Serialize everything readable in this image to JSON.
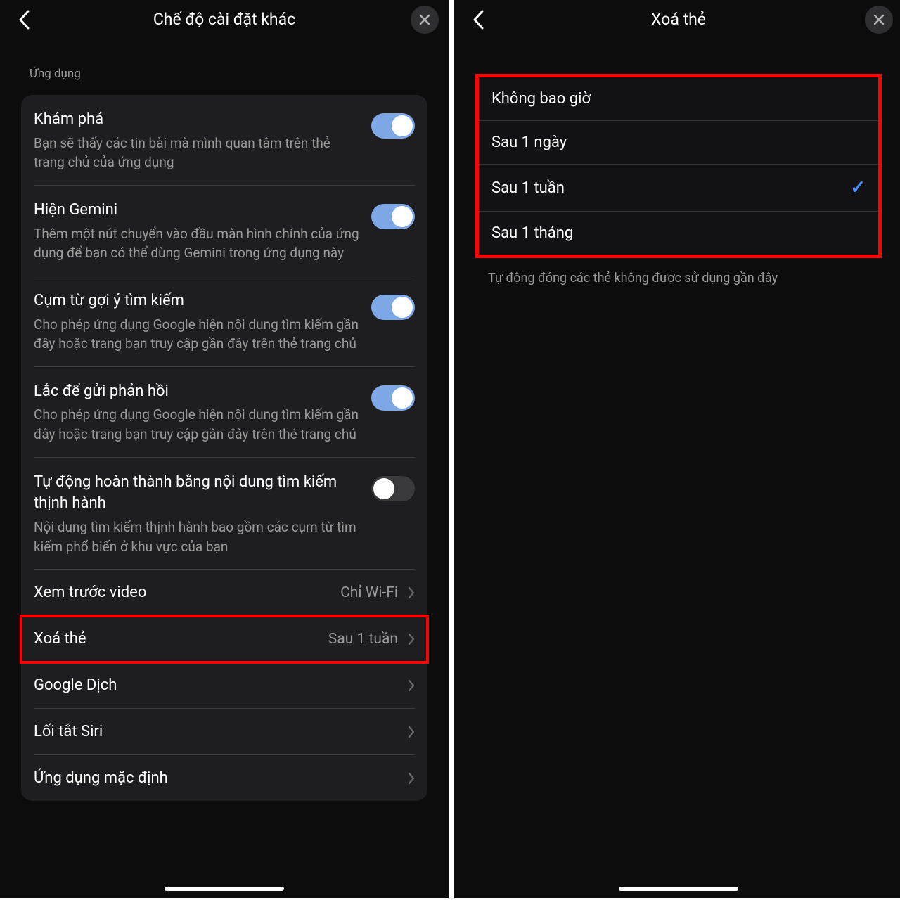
{
  "left": {
    "header": {
      "title": "Chế độ cài đặt khác"
    },
    "section_label": "Ứng dụng",
    "rows": [
      {
        "title": "Khám phá",
        "desc": "Bạn sẽ thấy các tin bài mà mình quan tâm trên thẻ trang chủ của ứng dụng",
        "toggle": true
      },
      {
        "title": "Hiện Gemini",
        "desc": "Thêm một nút chuyển vào đầu màn hình chính của ứng dụng để bạn có thể dùng Gemini trong ứng dụng này",
        "toggle": true
      },
      {
        "title": "Cụm từ gợi ý tìm kiếm",
        "desc": "Cho phép ứng dụng Google hiện nội dung tìm kiếm gần đây hoặc trang bạn truy cập gần đây trên thẻ trang chủ",
        "toggle": true
      },
      {
        "title": "Lắc để gửi phản hồi",
        "desc": "Cho phép ứng dụng Google hiện nội dung tìm kiếm gần đây hoặc trang bạn truy cập gần đây trên thẻ trang chủ",
        "toggle": true
      },
      {
        "title": "Tự động hoàn thành bằng nội dung tìm kiếm thịnh hành",
        "desc": "Nội dung tìm kiếm thịnh hành bao gồm các cụm từ tìm kiếm phổ biến ở khu vực của bạn",
        "toggle": false
      }
    ],
    "nav": [
      {
        "label": "Xem trước video",
        "value": "Chỉ Wi-Fi"
      },
      {
        "label": "Xoá thẻ",
        "value": "Sau 1 tuần",
        "highlight": true
      },
      {
        "label": "Google Dịch",
        "value": ""
      },
      {
        "label": "Lối tắt Siri",
        "value": ""
      },
      {
        "label": "Ứng dụng mặc định",
        "value": ""
      }
    ]
  },
  "right": {
    "header": {
      "title": "Xoá thẻ"
    },
    "options": [
      {
        "label": "Không bao giờ",
        "selected": false
      },
      {
        "label": "Sau 1 ngày",
        "selected": false
      },
      {
        "label": "Sau 1 tuần",
        "selected": true
      },
      {
        "label": "Sau 1 tháng",
        "selected": false
      }
    ],
    "footer": "Tự động đóng các thẻ không được sử dụng gần đây"
  }
}
